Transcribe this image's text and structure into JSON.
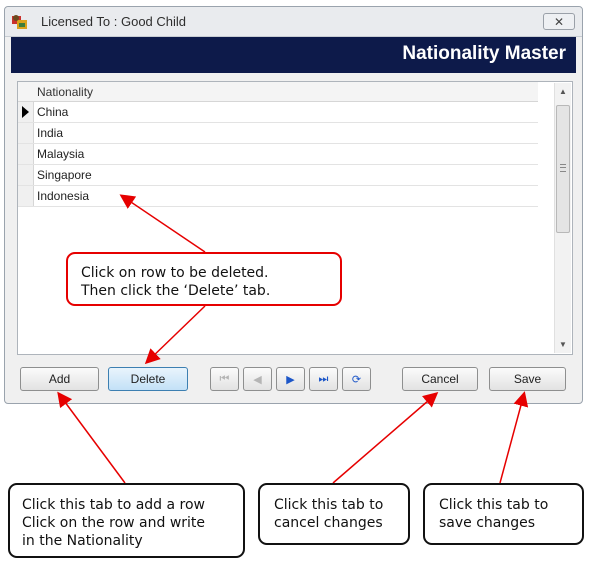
{
  "window": {
    "title": "Licensed To : Good Child",
    "close_label": "✕",
    "header_title": "Nationality Master"
  },
  "grid": {
    "column_header": "Nationality",
    "rows": [
      "China",
      "India",
      "Malaysia",
      "Singapore",
      "Indonesia"
    ]
  },
  "buttons": {
    "add": "Add",
    "delete": "Delete",
    "cancel": "Cancel",
    "save": "Save"
  },
  "nav": {
    "first": "⏮",
    "prev": "◀",
    "next": "▶",
    "last": "⏭",
    "refresh": "⟳"
  },
  "callouts": {
    "delete": [
      "Click on row to be deleted.",
      "Then click the ‘Delete’ tab."
    ],
    "add": [
      "Click this tab to add a row",
      "Click on the row and write",
      "in the Nationality"
    ],
    "cancel": [
      "Click this tab to",
      "cancel changes"
    ],
    "save": [
      "Click this tab to",
      "save changes"
    ]
  },
  "colors": {
    "header_band": "#0d1a4a",
    "annotation_red": "#e60000"
  }
}
